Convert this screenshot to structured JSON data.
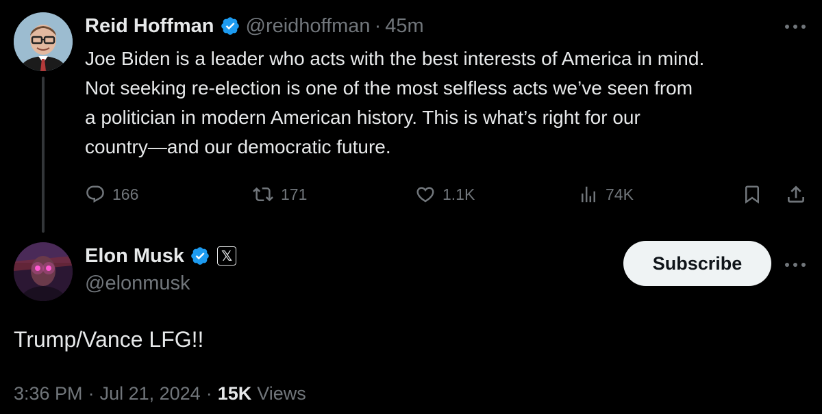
{
  "reply_to": {
    "author_name": "Reid Hoffman",
    "handle": "@reidhoffman",
    "separator": "·",
    "time": "45m",
    "text_lines": [
      "Joe Biden is a leader who acts with the best interests of America in mind.",
      "Not seeking re-election is one of the most selfless acts we’ve seen from",
      "a politician in modern American history. This is what’s right for our",
      "country—and our democratic future."
    ],
    "actions": {
      "replies": "166",
      "reposts": "171",
      "likes": "1.1K",
      "views": "74K"
    }
  },
  "main_post": {
    "author_name": "Elon Musk",
    "handle": "@elonmusk",
    "affiliate_badge": "𝕏",
    "subscribe_label": "Subscribe",
    "text": "Trump/Vance LFG!!",
    "timestamp_time": "3:36 PM",
    "separator": "·",
    "timestamp_date": "Jul 21, 2024",
    "views_count": "15K",
    "views_label": "Views"
  },
  "colors": {
    "background": "#000000",
    "text_primary": "#e7e9ea",
    "text_secondary": "#71767b",
    "verified_blue": "#1d9bf0",
    "button_bg": "#eff3f4"
  },
  "icons": [
    "verified-badge-icon",
    "more-icon",
    "reply-icon",
    "repost-icon",
    "like-icon",
    "analytics-icon",
    "bookmark-icon",
    "share-icon",
    "x-logo-icon"
  ]
}
